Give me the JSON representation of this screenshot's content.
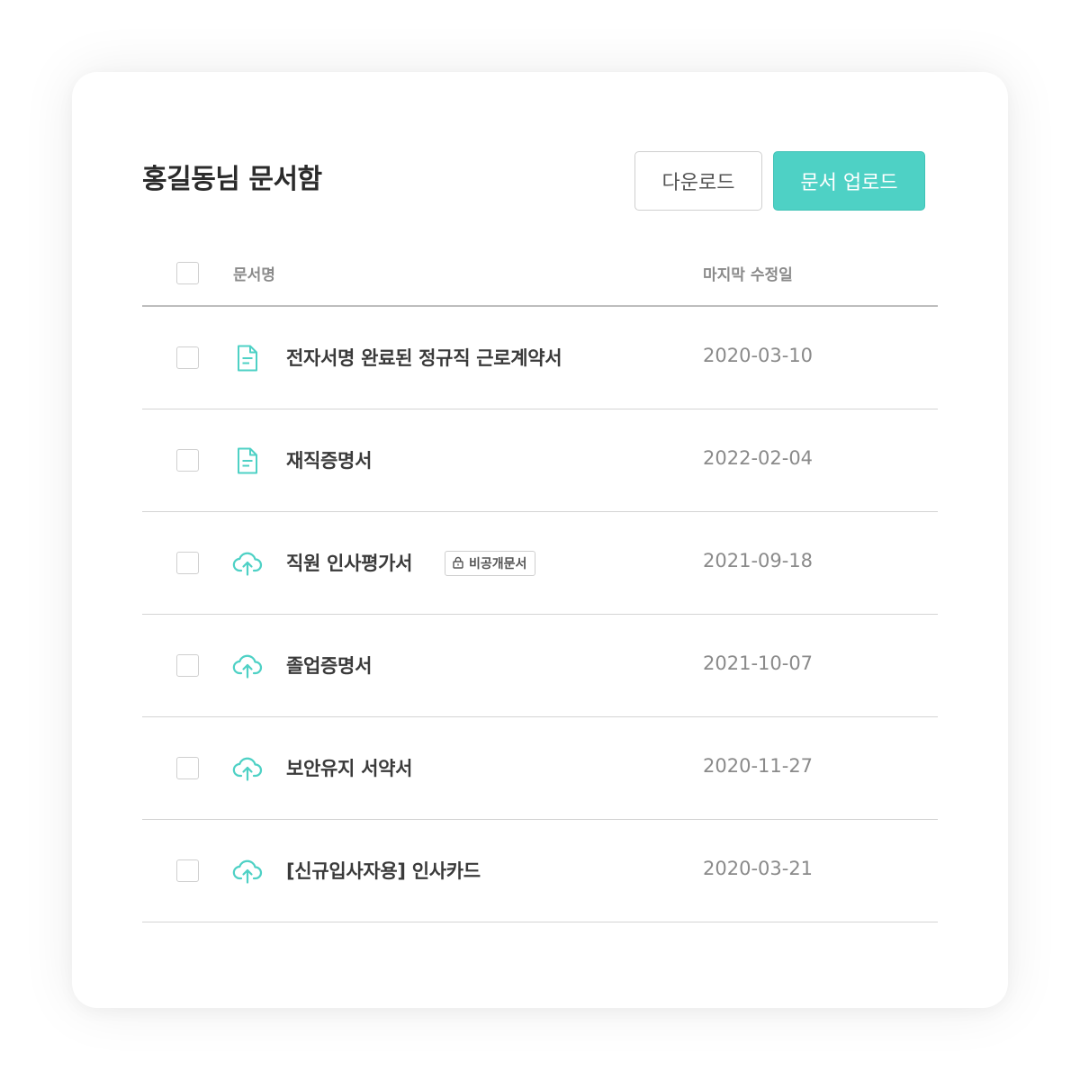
{
  "page_title": "홍길동님 문서함",
  "buttons": {
    "download": "다운로드",
    "upload": "문서 업로드"
  },
  "table": {
    "headers": {
      "name": "문서명",
      "modified": "마지막 수정일"
    },
    "rows": [
      {
        "icon": "document-icon",
        "name": "전자서명 완료된 정규직 근로계약서",
        "date": "2020-03-10"
      },
      {
        "icon": "document-icon",
        "name": "재직증명서",
        "date": "2022-02-04"
      },
      {
        "icon": "cloud-upload-icon",
        "name": "직원 인사평가서",
        "badge": "비공개문서",
        "date": "2021-09-18"
      },
      {
        "icon": "cloud-upload-icon",
        "name": "졸업증명서",
        "date": "2021-10-07"
      },
      {
        "icon": "cloud-upload-icon",
        "name": "보안유지 서약서",
        "date": "2020-11-27"
      },
      {
        "icon": "cloud-upload-icon",
        "name": "[신규입사자용] 인사카드",
        "date": "2020-03-21"
      }
    ]
  },
  "colors": {
    "accent": "#4ed1c5",
    "icon": "#4ed1c5",
    "text_primary": "#3a3a3a",
    "text_secondary": "#8a8a8a"
  }
}
